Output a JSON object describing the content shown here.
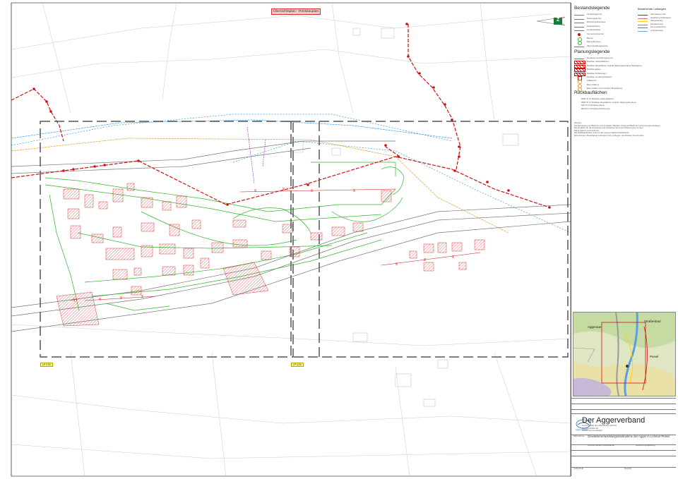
{
  "plan": {
    "stamp_label": "Übersichtsplan - Rückbauplan",
    "overview_labels": [
      "LP 4.00",
      "LP 4.00"
    ]
  },
  "legend": {
    "bestand_title": "Bestandslegende",
    "bestand_items": [
      "Flurstücksgrenze",
      "Nutzungsgrenze",
      "Böschungsoberkante",
      "Gebäudekante",
      "Gewässerkante",
      "Vermessungspunkt",
      "Bäume",
      "Baumpflanzung",
      "Weg Gestaltungsgrenze"
    ],
    "leitungen_title": "Bestehende Leitungen",
    "leitungen_items": [
      "Stromleitung Gas",
      "Gasleitung Trinkwasser",
      "Wasserleitung",
      "Entwässerung",
      "Fernmeldeleitung",
      "Leitungstrasse"
    ],
    "planung_title": "Planungslegende",
    "planung_items": [
      "Gewässer Gestaltungsgrenze",
      "Rückbau Geländeflächen",
      "Rückbau Wegeflächen Asphalt Wassergebundene Befestigung",
      "Rückbau Zäune",
      "Rückbau Schüttungen",
      "Rückbau von Einzelobjekten",
      "Fällbereich",
      "Baum Fällung",
      "Baum Fällen vom Gehölzen Beseitigung"
    ],
    "rueckbau_title": "Rückbauflächen",
    "rueckbau_items": [
      "9080,70 m²   Rückbau Geländeflächen",
      "3990,70 m²   Rückbau Wegeflächen Asphalt, Wassergebundene",
      "620,70 m²   Rückbau Zäune",
      "890,50 m²   Rückbau Schüttungen"
    ],
    "notes": [
      "Hinweis:",
      "Die Eintragung von Bäumen und sonstigen Objekten erfolgt auf Basis der Vermessungsunterlagen.",
      "Die Angaben für die Entsorgung der Gewässer sind nach Abstimmung mit dem",
      "Planungsbüro vorzunehmen.",
      "Die Rückbauarbeiten sind mit der unteren Naturschutzbehörde",
      "abzustimmen. Bestehende Leitungen sind vor Beginn der Arbeiten zu erkunden."
    ]
  },
  "inset": {
    "labels": [
      "Aggeraue",
      "Straßenbad",
      "Peisel"
    ]
  },
  "titleblock": {
    "org_name": "Der Aggerverband",
    "org_lines": [
      "Körperschaft des öffentlichen Rechts",
      "Sonnenstraße 40",
      "51645 Gummersbach"
    ],
    "logo_text": "Aggerverband",
    "section_label": "Maßnahme",
    "project_title": "Gewässerentwicklungsmaßnahme der Agger in Lohmar-Peisel",
    "plan_label": "Übersichtsplan Rückbauplan",
    "plan_kind": "Ausführungsplanung",
    "signature_left": "Aufgestellt",
    "signature_right": "Geprüft"
  },
  "north_arrow": {
    "label": "Z"
  },
  "colors": {
    "demolish": "#cc1111",
    "planned": "#2fb52f",
    "water": "#3a9be0",
    "gas": "#e0a020",
    "telecom": "#b040d0",
    "grid": "#555555"
  }
}
